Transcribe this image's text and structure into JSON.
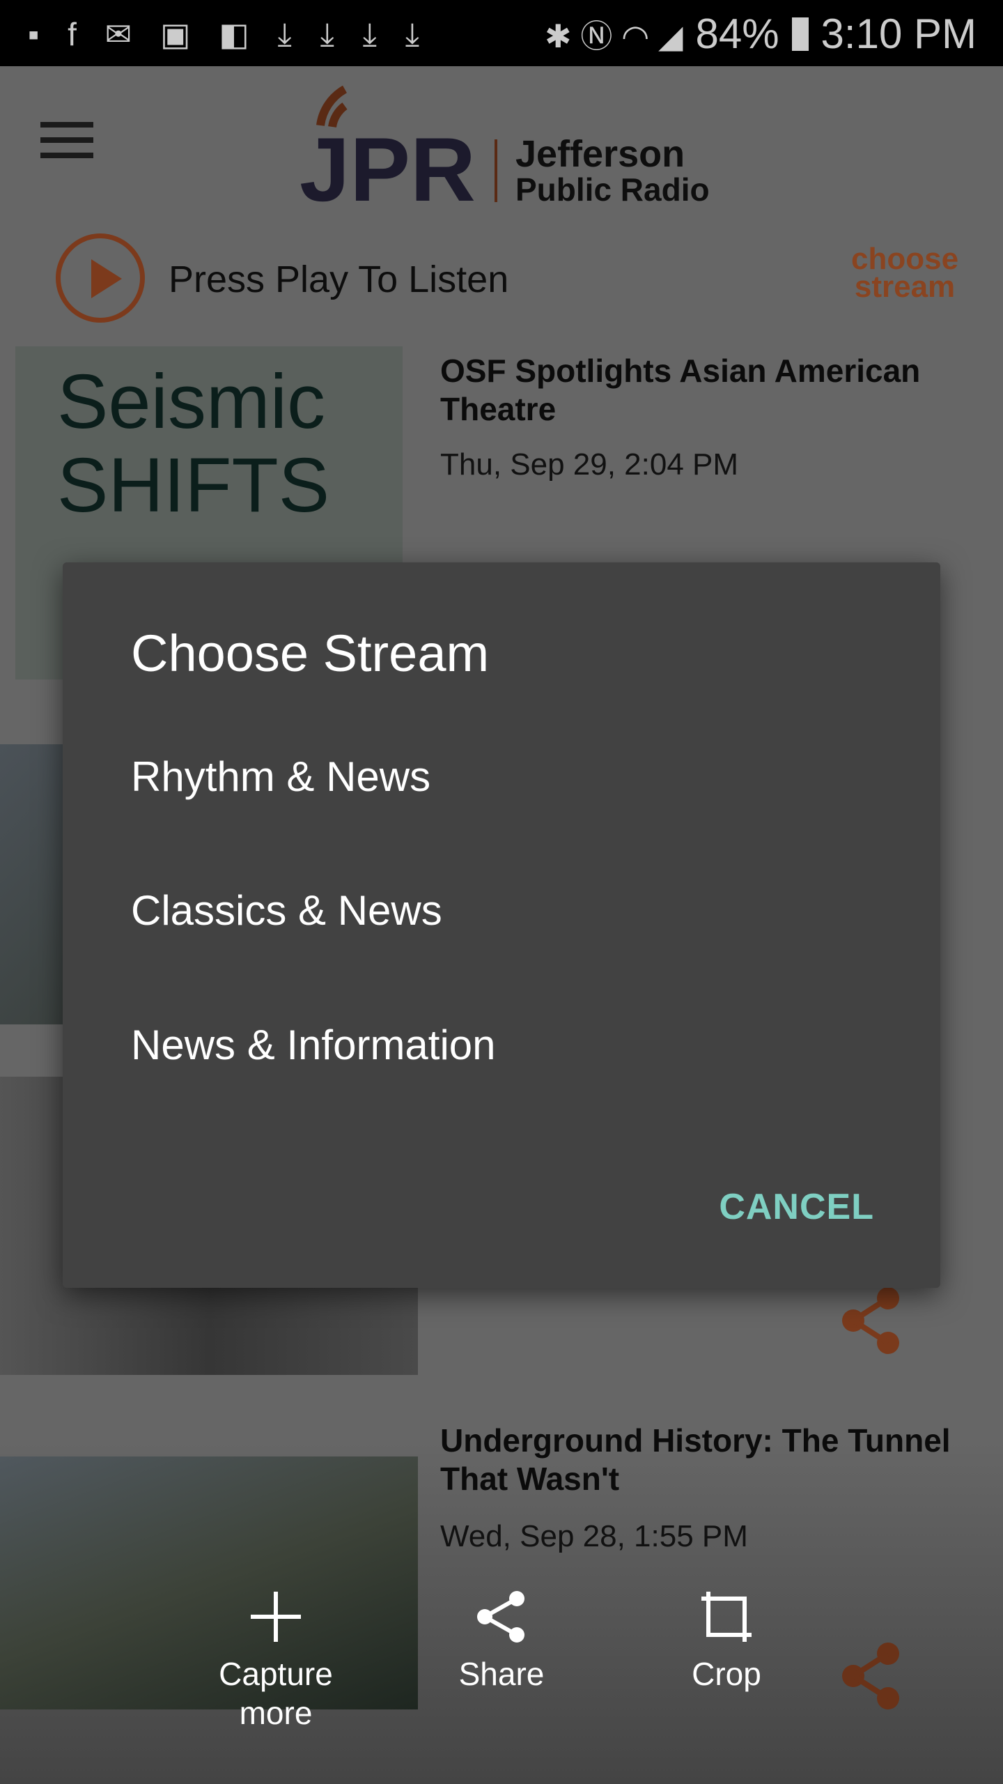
{
  "status_bar": {
    "battery": "84%",
    "time": "3:10 PM",
    "notification_icons": [
      "messages-icon",
      "facebook-icon",
      "gmail-icon",
      "gallery-icon",
      "flipboard-icon",
      "download-icon",
      "download-icon",
      "download-icon",
      "download-icon"
    ],
    "system_icons": [
      "bluetooth-icon",
      "nfc-icon",
      "wifi-icon",
      "signal-icon",
      "battery-icon"
    ]
  },
  "header": {
    "logo_text": "JPR",
    "logo_line1": "Jefferson",
    "logo_line2": "Public Radio"
  },
  "player": {
    "label": "Press Play To Listen",
    "choose_line1": "choose",
    "choose_line2": "stream"
  },
  "articles": [
    {
      "title": "OSF Spotlights Asian American Theatre",
      "date": "Thu, Sep 29, 2:04 PM",
      "image_text": "Seismic SHIFTS"
    },
    {
      "title": "Underground History: The Tunnel That Wasn't",
      "date": "Wed, Sep 28, 1:55 PM"
    }
  ],
  "dialog": {
    "title": "Choose Stream",
    "options": [
      "Rhythm & News",
      "Classics & News",
      "News & Information"
    ],
    "cancel": "CANCEL"
  },
  "screenshot_toolbar": {
    "capture_line1": "Capture",
    "capture_line2": "more",
    "share": "Share",
    "crop": "Crop"
  },
  "colors": {
    "accent": "#c0532a",
    "dialog_bg": "#424242",
    "cancel": "#7fcfc2"
  }
}
